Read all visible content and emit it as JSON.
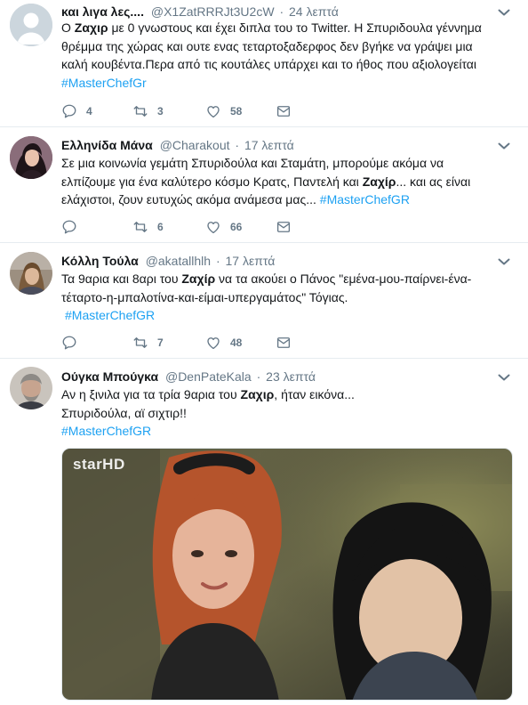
{
  "tweets": [
    {
      "name": "και λιγα λες....",
      "handle": "@X1ZatRRRJt3U2cW",
      "time": "24 λεπτά",
      "text_parts": [
        "Ο ",
        "Ζαχιρ",
        " με 0 γνωστους και έχει διπλα του το Twitter. Η Σπυριδουλα γέννημα",
        "θρέμμα της χώρας και ουτε ενας τεταρτοξαδερφος δεν βγήκε να γράψει μια",
        "καλή κουβέντα.Περα από τις  κουτάλες υπάρχει και το ήθος που αξιολογείται"
      ],
      "hashtag": "#MasterChefGr",
      "replies": "4",
      "retweets": "3",
      "likes": "58"
    },
    {
      "name": "Ελληνίδα Μάνα",
      "handle": "@Charakout",
      "time": "17 λεπτά",
      "text_parts": [
        "Σε μια κοινωνία γεμάτη Σπυριδούλα και Σταμάτη, μπορούμε ακόμα να",
        "ελπίζουμε για ένα καλύτερο κόσμο Κρατς, Παντελή και ",
        "Ζαχίρ",
        "... και ας είναι",
        "ελάχιστοι, ζουν ευτυχώς ακόμα ανάμεσα μας... "
      ],
      "hashtag": "#MasterChefGR",
      "replies": "",
      "retweets": "6",
      "likes": "66"
    },
    {
      "name": "Κόλλη Τούλα",
      "handle": "@akatallhlh",
      "time": "17 λεπτά",
      "text_parts": [
        "Τα 9αρια και 8αρι του ",
        "Ζαχίρ",
        " να τα ακούει ο Πάνος \"εμένα-μου-παίρνει-ένα-",
        "τέταρτο-η-μπαλοτίνα-και-είμαι-υπεργαμάτος\" Τόγιας."
      ],
      "hashtag": "#MasterChefGR",
      "replies": "",
      "retweets": "7",
      "likes": "48"
    },
    {
      "name": "Ούγκα Μπούγκα",
      "handle": "@DenPateKala",
      "time": "23 λεπτά",
      "text_parts": [
        "Αν η ξινιλα για τα τρία 9αρια του ",
        "Ζαχιρ",
        ", ήταν εικόνα...",
        "Σπυριδούλα, αϊ σιχτιρ!!"
      ],
      "hashtag": "#MasterChefGR",
      "media_logo": "starHD"
    }
  ],
  "dot": "·",
  "icons": [
    "reply-icon",
    "retweet-icon",
    "like-icon",
    "message-icon",
    "chevron-down-icon"
  ],
  "colors": {
    "link": "#1da1f2",
    "muted": "#657786",
    "text": "#14171a",
    "divider": "#e6ecf0"
  }
}
